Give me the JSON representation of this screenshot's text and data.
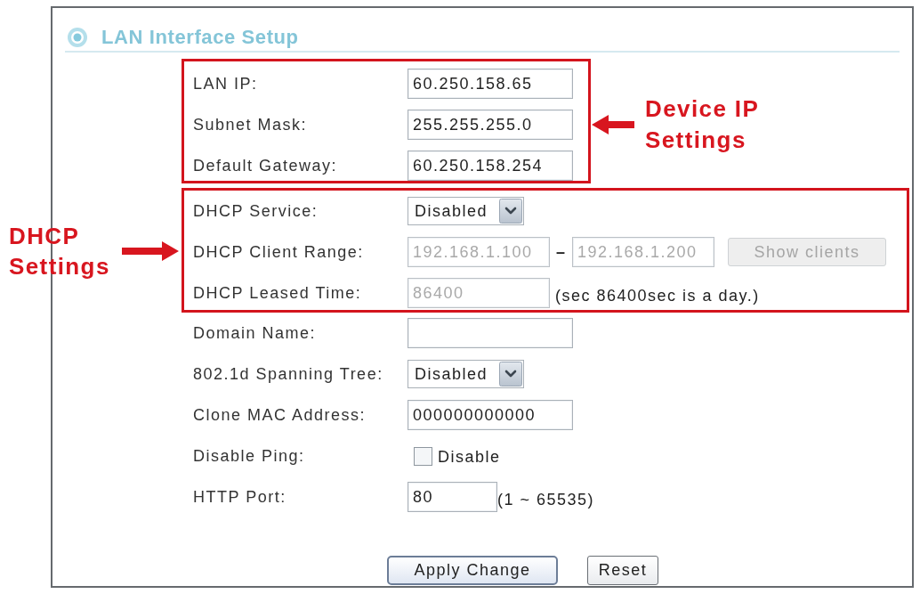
{
  "panel": {
    "title": "LAN Interface Setup"
  },
  "groups": [
    {
      "highlighted": true,
      "callout": {
        "text": "Device IP Settings",
        "kind": "right"
      },
      "rows": [
        {
          "kind": "text",
          "label": "LAN IP:",
          "value": "60.250.158.65",
          "disabled": false
        },
        {
          "kind": "text",
          "label": "Subnet Mask:",
          "value": "255.255.255.0",
          "disabled": false
        },
        {
          "kind": "text",
          "label": "Default Gateway:",
          "value": "60.250.158.254",
          "disabled": false
        }
      ]
    },
    {
      "highlighted": true,
      "callout": {
        "text": "DHCP Settings",
        "kind": "left"
      },
      "rows": [
        {
          "kind": "select",
          "label": "DHCP Service:",
          "value": "Disabled",
          "disabled": false
        },
        {
          "kind": "range",
          "label": "DHCP Client Range:",
          "from": "192.168.1.100",
          "separator": "–",
          "to": "192.168.1.200",
          "disabled": true,
          "button": {
            "label": "Show clients",
            "disabled": true
          }
        },
        {
          "kind": "text",
          "label": "DHCP Leased Time:",
          "value": "86400",
          "disabled": true,
          "note": "(sec 86400sec is a day.)"
        }
      ]
    },
    {
      "highlighted": false,
      "rows": [
        {
          "kind": "text",
          "label": "Domain Name:",
          "disabled": false
        },
        {
          "kind": "select",
          "label": "802.1d Spanning Tree:",
          "value": "Disabled",
          "disabled": false
        },
        {
          "kind": "text",
          "label": "Clone MAC Address:",
          "value": "000000000000",
          "disabled": false
        },
        {
          "kind": "checkbox",
          "label": "Disable Ping:",
          "option": "Disable",
          "checked": false,
          "disabled": false
        },
        {
          "kind": "text",
          "label": "HTTP Port:",
          "value": "80",
          "disabled": false,
          "note": "(1 ~ 65535)"
        }
      ]
    }
  ],
  "buttons": [
    {
      "label": "Apply Change",
      "kind": "primary"
    },
    {
      "label": "Reset",
      "kind": "secondary"
    }
  ]
}
